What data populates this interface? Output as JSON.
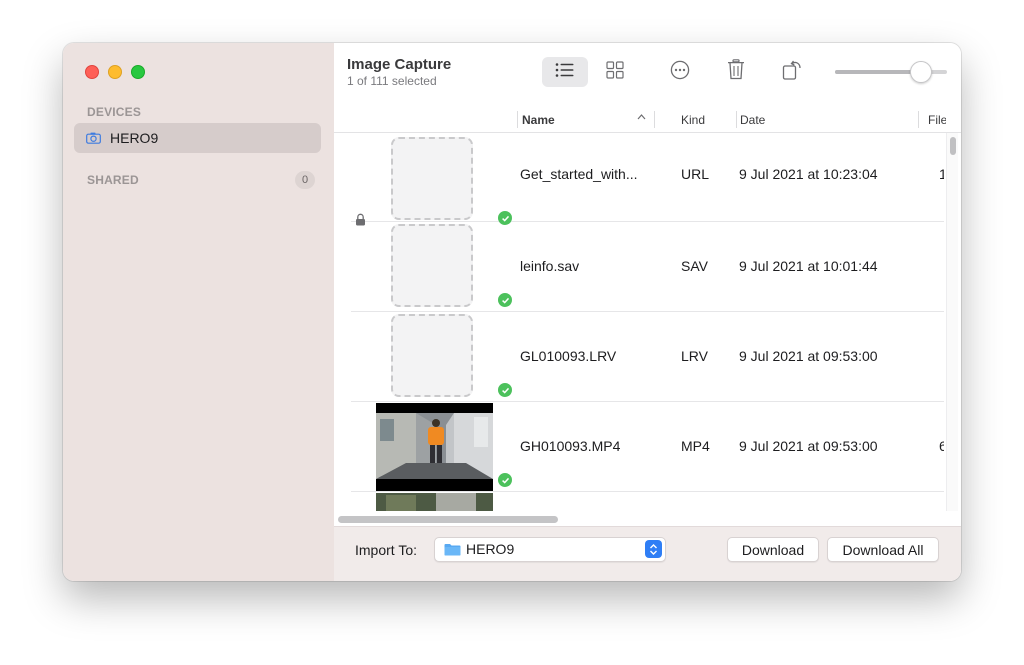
{
  "app": {
    "title": "Image Capture",
    "subtitle": "1 of 111 selected"
  },
  "sidebar": {
    "devices_label": "DEVICES",
    "device_name": "HERO9",
    "shared_label": "SHARED",
    "shared_count": "0"
  },
  "toolbar": {
    "icons": [
      "list-view-icon",
      "grid-view-icon",
      "more-icon",
      "trash-icon",
      "rotate-icon"
    ],
    "thumbnail_size_fraction": 0.82
  },
  "table": {
    "columns": {
      "name": "Name",
      "kind": "Kind",
      "date": "Date",
      "file": "File"
    },
    "sort_column": "Name",
    "rows": [
      {
        "name": "Get_started_with...",
        "kind": "URL",
        "date": "9 Jul 2021 at 10:23:04",
        "extra": "1",
        "locked": true,
        "thumb": "placeholder",
        "downloaded": true
      },
      {
        "name": "leinfo.sav",
        "kind": "SAV",
        "date": "9 Jul 2021 at 10:01:44",
        "extra": "",
        "locked": false,
        "thumb": "placeholder",
        "downloaded": true
      },
      {
        "name": "GL010093.LRV",
        "kind": "LRV",
        "date": "9 Jul 2021 at 09:53:00",
        "extra": "",
        "locked": false,
        "thumb": "placeholder",
        "downloaded": true
      },
      {
        "name": "GH010093.MP4",
        "kind": "MP4",
        "date": "9 Jul 2021 at 09:53:00",
        "extra": "6",
        "locked": false,
        "thumb": "video",
        "downloaded": true
      }
    ]
  },
  "bottom": {
    "import_label": "Import To:",
    "destination": "HERO9",
    "download_label": "Download",
    "download_all_label": "Download All"
  },
  "colors": {
    "sidebar_bg": "#ece2e0",
    "selection": "#d6cccb",
    "accent": "#2f7ef5",
    "check": "#4cc15c"
  }
}
